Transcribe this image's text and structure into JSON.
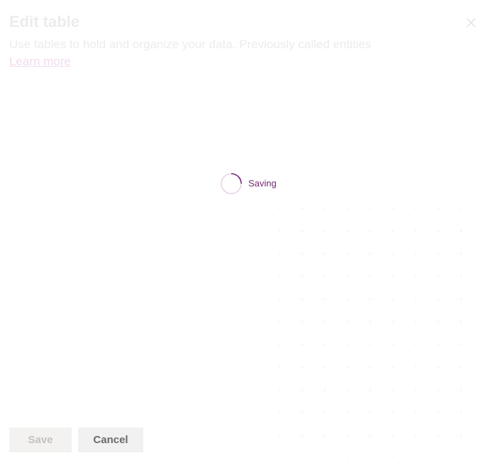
{
  "dialog": {
    "title": "Edit table",
    "description": "Use tables to hold and organize your data. Previously called entities",
    "learn_more_label": "Learn more",
    "close_icon": "close-icon"
  },
  "loading": {
    "spinner_icon": "spinner-icon",
    "label": "Saving"
  },
  "footer": {
    "save_label": "Save",
    "cancel_label": "Cancel"
  },
  "colors": {
    "accent": "#742774",
    "spinner_track": "#e8d3e8",
    "faded_text": "#ececec",
    "button_bg": "#f3f2f1"
  }
}
